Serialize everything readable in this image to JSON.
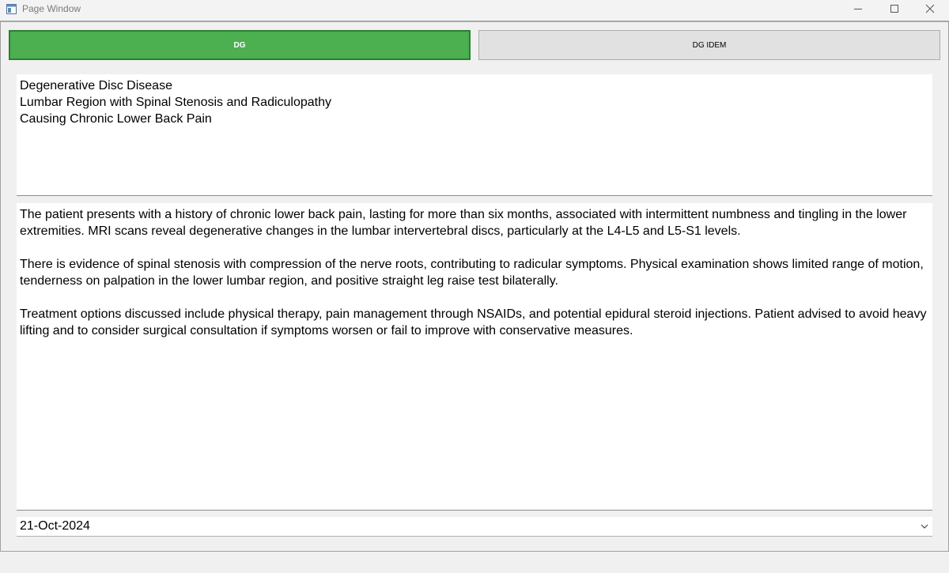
{
  "window": {
    "title": "Page Window",
    "icons": [
      "app-icon",
      "minimize-icon",
      "maximize-icon",
      "close-icon"
    ]
  },
  "tabs": [
    {
      "label": "DG",
      "active": true,
      "color": "#4caf50"
    },
    {
      "label": "DG IDEM",
      "active": false,
      "color": "#e1e1e1"
    }
  ],
  "diagnosis": {
    "lines": [
      "Degenerative Disc Disease",
      "Lumbar Region with Spinal Stenosis and Radiculopathy",
      "Causing Chronic Lower Back Pain"
    ]
  },
  "notes": {
    "paragraphs": [
      "The patient presents with a history of chronic lower back pain, lasting for more than six months, associated with intermittent numbness and tingling in the lower extremities. MRI scans reveal degenerative changes in the lumbar intervertebral discs, particularly at the L4-L5 and L5-S1 levels.",
      "There is evidence of spinal stenosis with compression of the nerve roots, contributing to radicular symptoms. Physical examination shows limited range of motion, tenderness on palpation in the lower lumbar region, and positive straight leg raise test bilaterally.",
      "Treatment options discussed include physical therapy, pain management through NSAIDs, and potential epidural steroid injections. Patient advised to avoid heavy lifting and to consider surgical consultation if symptoms worsen or fail to improve with conservative measures."
    ]
  },
  "date_select": {
    "value": "21-Oct-2024"
  }
}
